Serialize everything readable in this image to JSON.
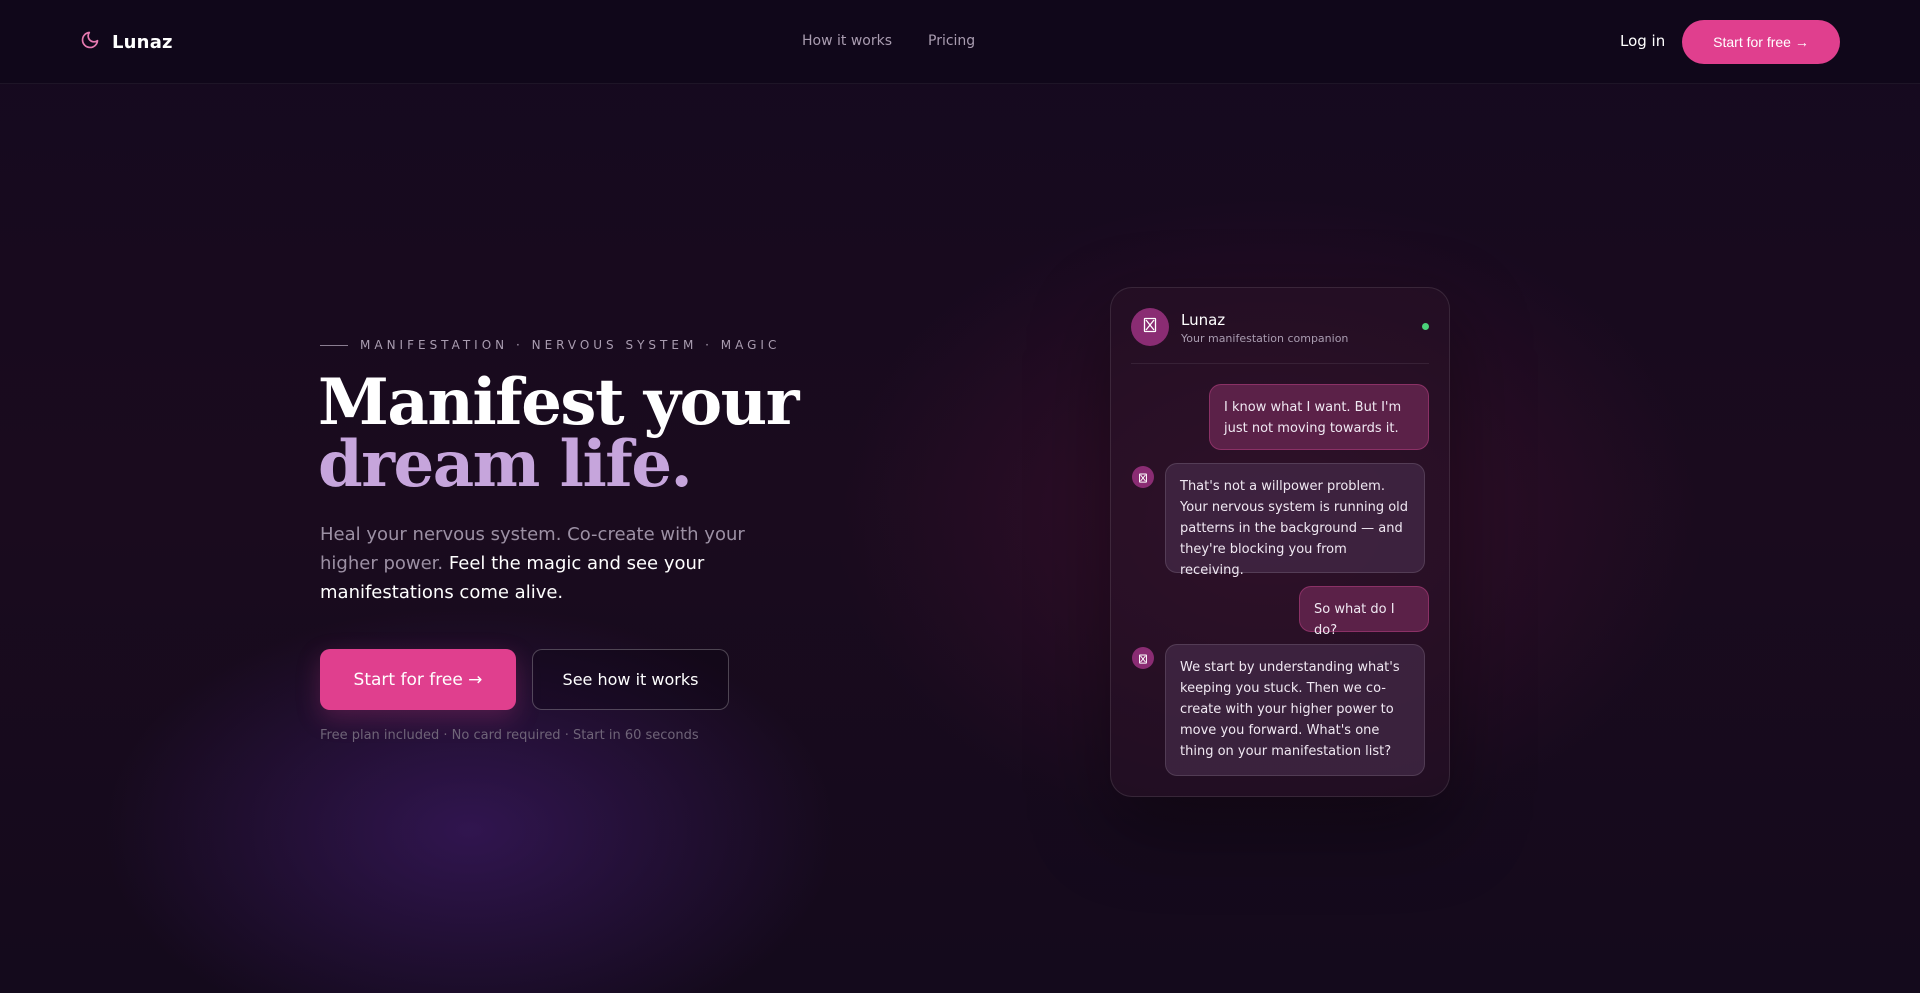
{
  "nav": {
    "brand": "Lunaz",
    "links": [
      "How it works",
      "Pricing"
    ],
    "login": "Log in",
    "cta": "Start for free →"
  },
  "hero": {
    "eyebrow": "MANIFESTATION · NERVOUS SYSTEM · MAGIC",
    "title_line1": "Manifest your",
    "title_line2": "dream life.",
    "subtitle_plain": "Heal your nervous system. Co-create with your higher power.",
    "subtitle_strong": "Feel the magic and see your manifestations come alive.",
    "primary_cta": "Start for free →",
    "secondary_cta": "See how it works",
    "fine_print": "Free plan included · No card required · Start in 60 seconds"
  },
  "chat": {
    "name": "Lunaz",
    "subtitle": "Your manifestation companion",
    "status_color": "#4bd17a",
    "messages": [
      {
        "from": "user",
        "text": "I know what I want. But I'm just not moving towards it."
      },
      {
        "from": "bot",
        "text": "That's not a willpower problem. Your nervous system is running old patterns in the background — and they're blocking you from receiving."
      },
      {
        "from": "user",
        "text": "So what do I do?"
      },
      {
        "from": "bot",
        "text": "We start by understanding what's keeping you stuck. Then we co-create with your higher power to move you forward. What's one thing on your manifestation list?"
      }
    ]
  },
  "colors": {
    "accent": "#e03f8e",
    "title_highlight": "#c6a5dc",
    "background": "#15091f"
  }
}
